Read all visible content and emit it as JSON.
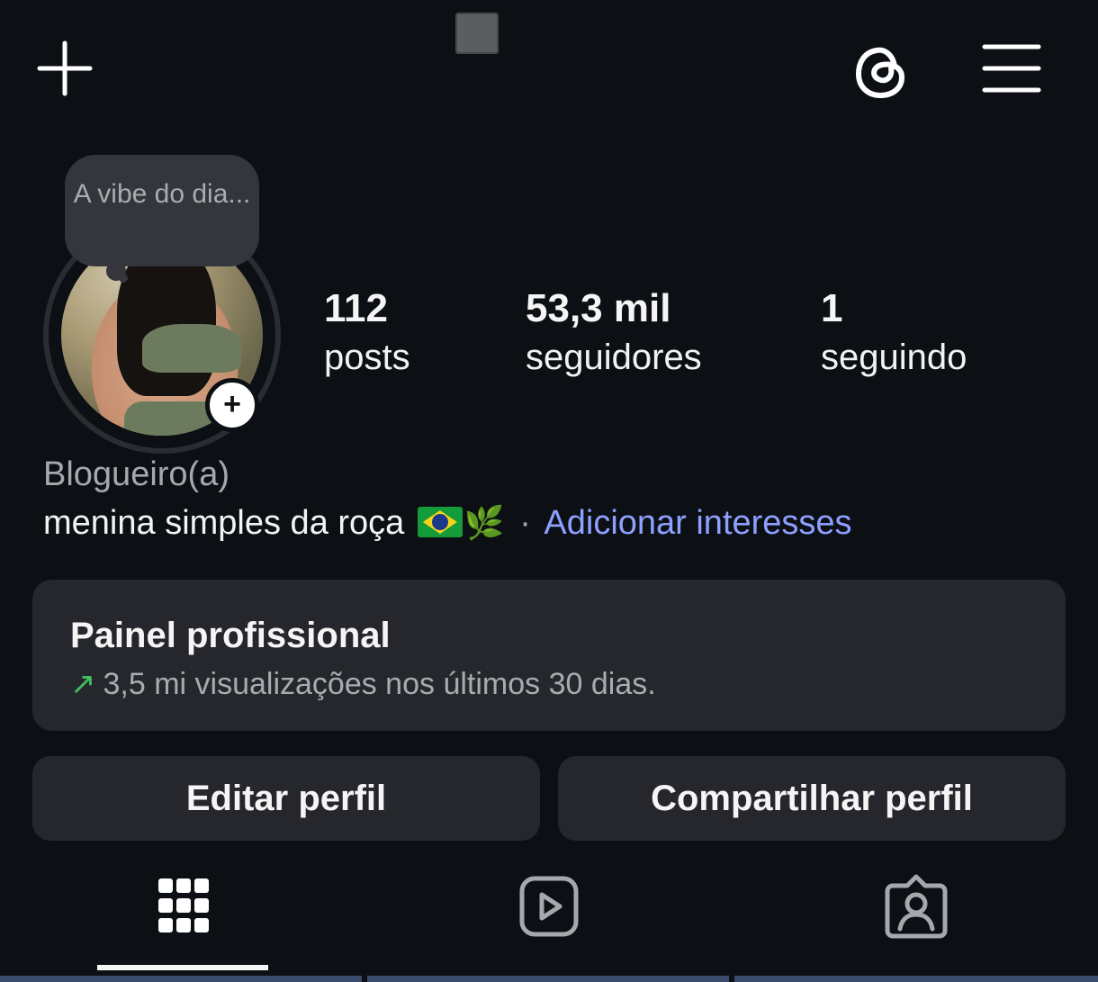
{
  "top_bar": {
    "icons": [
      "plus-icon",
      "threads-icon",
      "menu-icon"
    ]
  },
  "note": {
    "text": "A vibe do dia..."
  },
  "stats": {
    "posts": {
      "value": "112",
      "label": "posts"
    },
    "followers": {
      "value": "53,3 mil",
      "label": "seguidores"
    },
    "following": {
      "value": "1",
      "label": "seguindo"
    }
  },
  "profile": {
    "category": "Blogueiro(a)",
    "bio": "menina simples da roça",
    "bio_emojis": "🇧🇷🌿",
    "separator": "·",
    "add_interests": "Adicionar interesses"
  },
  "pro_dashboard": {
    "title": "Painel profissional",
    "stats": "3,5 mi visualizações nos últimos 30 dias.",
    "trend_icon": "arrow-up-right-icon",
    "trend_color": "#3fbf5f"
  },
  "buttons": {
    "edit": "Editar perfil",
    "share": "Compartilhar perfil"
  },
  "tabs": [
    {
      "name": "grid",
      "icon": "grid-icon",
      "active": true
    },
    {
      "name": "reels",
      "icon": "reels-icon",
      "active": false
    },
    {
      "name": "tagged",
      "icon": "tagged-icon",
      "active": false
    }
  ],
  "colors": {
    "background": "#0c0f14",
    "card": "#25272c",
    "link": "#8ea0ff",
    "muted_text": "#a6a8ad"
  }
}
